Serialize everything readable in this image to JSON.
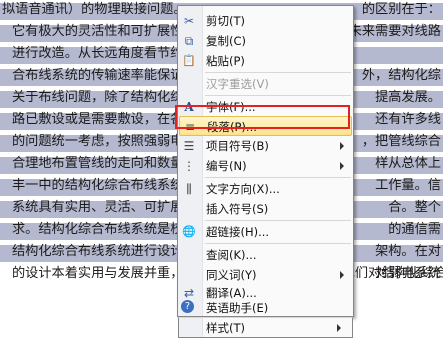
{
  "document": {
    "lines": [
      "拟语音通讯）的物理联接问题。",
      "它有极大的灵活性和可扩展性",
      "进行改造。从长远角度看节约了",
      "合布线系统的传输速率能保证相",
      "关于布线问题，除了结构化综合",
      "路已敷设或是需要敷设，在各方",
      "的问题统一考虑，按照强弱电分",
      "合理地布置管线的走向和数量，",
      "丰一中的结构化综合布线系统应",
      "系统具有实用、灵活、可扩展、",
      "求。结构化综合布线系统是校园",
      "结构化综合布线系统进行设计时必须考虑",
      "的设计本着实用与发展并重，一次设计分步实施的原则。我们对结构化综合布"
    ],
    "right_fragments": [
      "的区别在于：",
      "未来需要对线路",
      "外，结构化综",
      "提高发展。",
      "还有许多线",
      "，把管线综合",
      "样从总体上",
      "工作量。信",
      "合。整个",
      "的通信需",
      "架构。在对",
      "对弱电系统"
    ]
  },
  "context_menu": {
    "items": [
      {
        "label": "剪切(T)",
        "icon": "scissors-icon",
        "glyph": "✂",
        "enabled": true,
        "submenu": false
      },
      {
        "label": "复制(C)",
        "icon": "copy-icon",
        "glyph": "⧉",
        "enabled": true,
        "submenu": false
      },
      {
        "label": "粘贴(P)",
        "icon": "paste-icon",
        "glyph": "📋",
        "enabled": true,
        "submenu": false
      },
      {
        "label": "汉字重选(V)",
        "icon": "",
        "glyph": "",
        "enabled": false,
        "submenu": false
      },
      {
        "label": "字体(F)...",
        "icon": "font-icon",
        "glyph": "A",
        "enabled": true,
        "submenu": false
      },
      {
        "label": "段落(P)...",
        "icon": "paragraph-icon",
        "glyph": "≡",
        "enabled": true,
        "submenu": false,
        "highlighted": true
      },
      {
        "label": "项目符号(B)",
        "icon": "bullets-icon",
        "glyph": "☰",
        "enabled": true,
        "submenu": true
      },
      {
        "label": "编号(N)",
        "icon": "numbering-icon",
        "glyph": "⋮",
        "enabled": true,
        "submenu": true
      },
      {
        "label": "文字方向(X)...",
        "icon": "text-direction-icon",
        "glyph": "⫼",
        "enabled": true,
        "submenu": false
      },
      {
        "label": "插入符号(S)",
        "icon": "",
        "glyph": "",
        "enabled": true,
        "submenu": false
      },
      {
        "label": "超链接(H)...",
        "icon": "hyperlink-icon",
        "glyph": "🌐",
        "enabled": true,
        "submenu": false
      },
      {
        "label": "查阅(K)...",
        "icon": "",
        "glyph": "",
        "enabled": true,
        "submenu": false
      },
      {
        "label": "同义词(Y)",
        "icon": "",
        "glyph": "",
        "enabled": true,
        "submenu": true
      },
      {
        "label": "翻译(A)...",
        "icon": "translate-icon",
        "glyph": "⇄",
        "enabled": true,
        "submenu": false
      },
      {
        "label": "英语助手(E)",
        "icon": "english-assistant-icon",
        "glyph": "?",
        "enabled": true,
        "submenu": false
      },
      {
        "label": "样式(T)",
        "icon": "",
        "glyph": "",
        "enabled": true,
        "submenu": true
      }
    ]
  },
  "colors": {
    "selection": "#b5b9cf",
    "highlight_border": "#e32222",
    "menu_hover": "#ffe28a"
  }
}
